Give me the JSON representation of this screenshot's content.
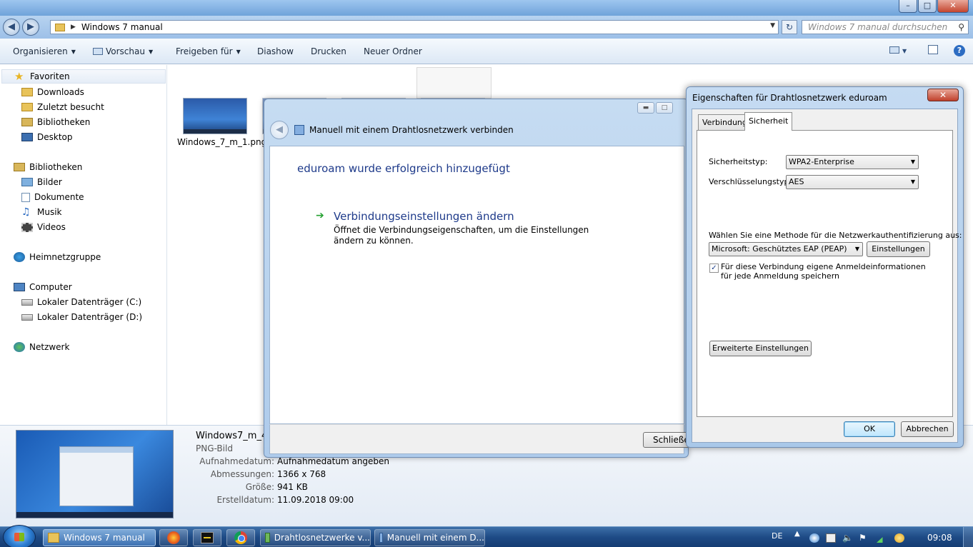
{
  "explorer": {
    "address": {
      "crumb": "Windows 7 manual",
      "search_placeholder": "Windows 7 manual durchsuchen"
    },
    "caption": {
      "minimize": "–",
      "maximize": "□",
      "close": "✕"
    },
    "toolbar": {
      "organize": "Organisieren",
      "preview": "Vorschau",
      "share": "Freigeben für",
      "slideshow": "Diashow",
      "print": "Drucken",
      "new_folder": "Neuer Ordner",
      "help": "?"
    },
    "nav": {
      "favorites": "Favoriten",
      "downloads": "Downloads",
      "recent": "Zuletzt besucht",
      "fav_libraries": "Bibliotheken",
      "desktop": "Desktop",
      "libraries": "Bibliotheken",
      "pictures": "Bilder",
      "documents": "Dokumente",
      "music": "Musik",
      "videos": "Videos",
      "homegroup": "Heimnetzgruppe",
      "computer": "Computer",
      "drive_c": "Lokaler Datenträger (C:)",
      "drive_d": "Lokaler Datenträger (D:)",
      "network": "Netzwerk"
    },
    "file_label": "Windows_7_m_1.png",
    "details": {
      "name": "Windows7_m_4.png",
      "type": "PNG-Bild",
      "rows": [
        {
          "key": "Aufnahmedatum:",
          "value": "Aufnahmedatum angeben"
        },
        {
          "key": "Abmessungen:",
          "value": "1366 x 768"
        },
        {
          "key": "Größe:",
          "value": "941 KB"
        },
        {
          "key": "Erstelldatum:",
          "value": "11.09.2018 09:00"
        }
      ]
    }
  },
  "wizard": {
    "title": "Manuell mit einem Drahtlosnetzwerk verbinden",
    "heading": "eduroam wurde erfolgreich hinzugefügt",
    "link": "Verbindungseinstellungen ändern",
    "link_description": "Öffnet die Verbindungseigenschaften, um die Einstellungen ändern zu können.",
    "close_button": "Schließen"
  },
  "properties": {
    "title": "Eigenschaften für Drahtlosnetzwerk eduroam",
    "close": "✕",
    "tabs": [
      "Verbindung",
      "Sicherheit"
    ],
    "security_type_label": "Sicherheitstyp:",
    "security_type_value": "WPA2-Enterprise",
    "encryption_label": "Verschlüsselungstyp:",
    "encryption_value": "AES",
    "method_label": "Wählen Sie eine Methode für die Netzwerkauthentifizierung aus:",
    "method_value": "Microsoft: Geschütztes EAP (PEAP)",
    "settings_button": "Einstellungen",
    "remember_checkbox": "Für diese Verbindung eigene Anmeldeinformationen für jede Anmeldung speichern",
    "remember_checked": true,
    "advanced_button": "Erweiterte Einstellungen",
    "ok_button": "OK",
    "cancel_button": "Abbrechen"
  },
  "taskbar": {
    "items": [
      {
        "label": "Windows 7 manual",
        "active": true
      },
      {
        "label": "Drahtlosnetzwerke v..."
      },
      {
        "label": "Manuell mit einem D..."
      }
    ],
    "language": "DE",
    "clock": "09:08"
  }
}
